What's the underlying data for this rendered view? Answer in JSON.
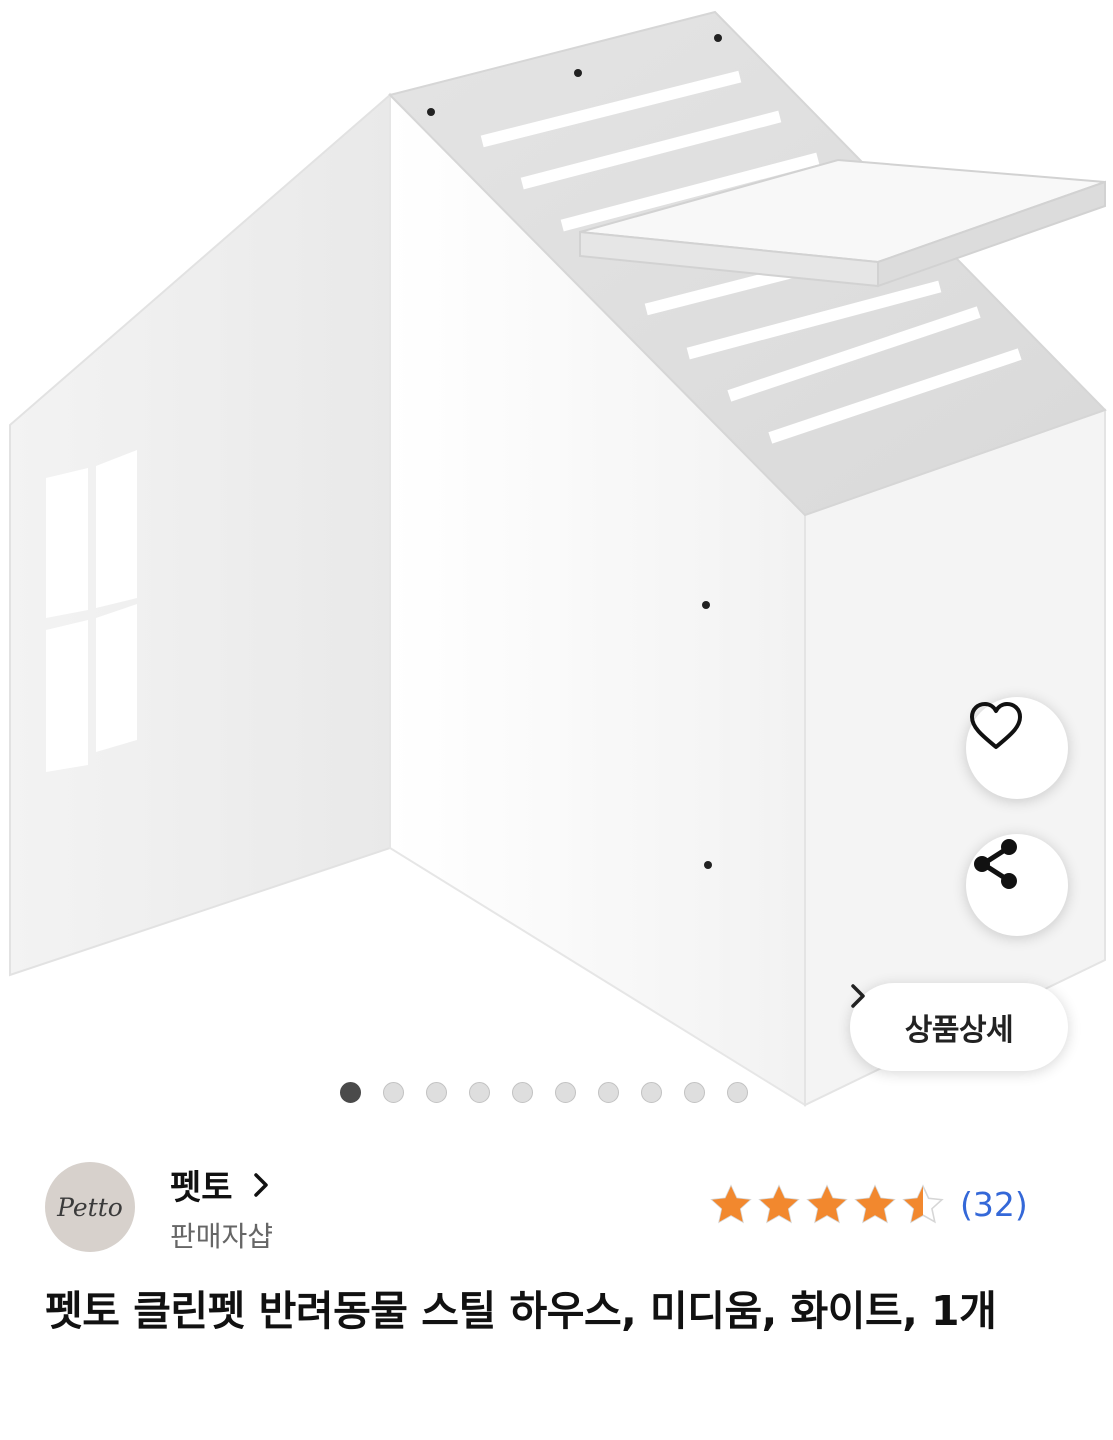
{
  "hero": {
    "image_alt": "white steel pet house",
    "dots_total": 10,
    "dots_active_index": 0
  },
  "actions": {
    "wishlist_icon": "heart-icon",
    "share_icon": "share-icon",
    "detail_label": "상품상세",
    "detail_icon": "chevron-right-icon"
  },
  "seller": {
    "logo_text": "Petto",
    "name": "펫토",
    "subtitle": "판매자샵"
  },
  "rating": {
    "stars": 4.5,
    "max_stars": 5,
    "review_count": "(32)",
    "star_color": "#f2882e",
    "count_color": "#3468d8"
  },
  "product": {
    "title": "펫토 클린펫 반려동물 스틸 하우스, 미디움, 화이트, 1개"
  }
}
